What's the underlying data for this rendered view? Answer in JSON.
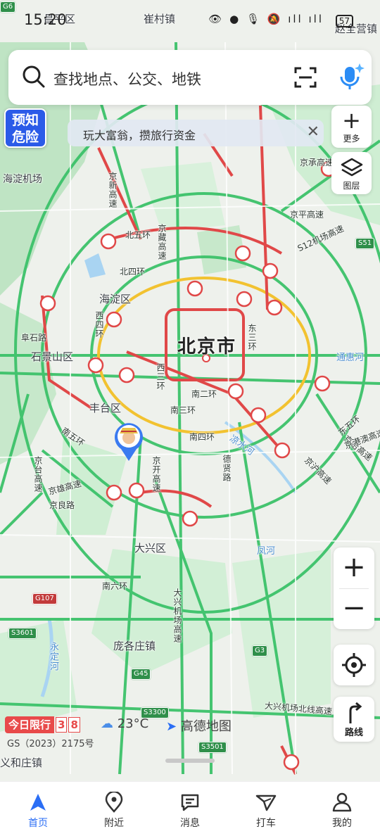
{
  "status_bar": {
    "time": "15:20",
    "icons": "👁 ● 🎙 🔕 ıll ıll",
    "battery": "57"
  },
  "search": {
    "placeholder": "查找地点、公交、地铁",
    "icons": [
      "search-icon",
      "scan-icon",
      "voice-assistant-icon"
    ]
  },
  "warning_badge": {
    "line1": "预知",
    "line2": "危险"
  },
  "tip": {
    "text": "玩大富翁，攒旅行资金"
  },
  "side_buttons": {
    "more": "更多",
    "layers": "图层"
  },
  "map": {
    "city": "北京市",
    "districts": [
      "海淀区",
      "石景山区",
      "丰台区",
      "大兴区",
      "庞各庄镇",
      "崔村镇",
      "昌平区",
      "赵全营镇",
      "义和庄镇",
      "海淀机场"
    ],
    "roads": [
      "北五环",
      "北四环",
      "南二环",
      "南三环",
      "南四环",
      "南五环",
      "南六环",
      "京藏高速",
      "京新高速",
      "京平高速",
      "S12机场高速",
      "京哈高速",
      "京沪高速",
      "京开高速",
      "京雄高速",
      "京良路",
      "德贤路",
      "东三环",
      "西四环",
      "西三环",
      "通惠河",
      "京台高速",
      "大兴机场高速",
      "大兴机场北线高速",
      "京承高速",
      "阜石路",
      "东五环",
      "京港澳高速",
      "京礼高速",
      "凉水河",
      "凤河",
      "永定河"
    ],
    "shields": [
      "G6",
      "S51",
      "G107",
      "S3601",
      "G45",
      "S3300",
      "G3",
      "S3501"
    ]
  },
  "bottom_info": {
    "restriction_label": "今日限行",
    "restriction_digits": [
      "3",
      "8"
    ],
    "weather": "23°C",
    "logo": "高德地图",
    "copyright": "GS（2023）2175号"
  },
  "route_button": "路线",
  "tabs": [
    {
      "label": "首页",
      "icon": "home-arrow-icon",
      "active": true
    },
    {
      "label": "附近",
      "icon": "location-pin-icon",
      "active": false
    },
    {
      "label": "消息",
      "icon": "message-icon",
      "active": false
    },
    {
      "label": "打车",
      "icon": "taxi-icon",
      "active": false
    },
    {
      "label": "我的",
      "icon": "profile-icon",
      "active": false
    }
  ],
  "colors": {
    "accent": "#2b6ef5",
    "traffic_green": "#3cc26a",
    "traffic_red": "#e04848",
    "traffic_yellow": "#f2c230",
    "highway": "#39b868"
  }
}
